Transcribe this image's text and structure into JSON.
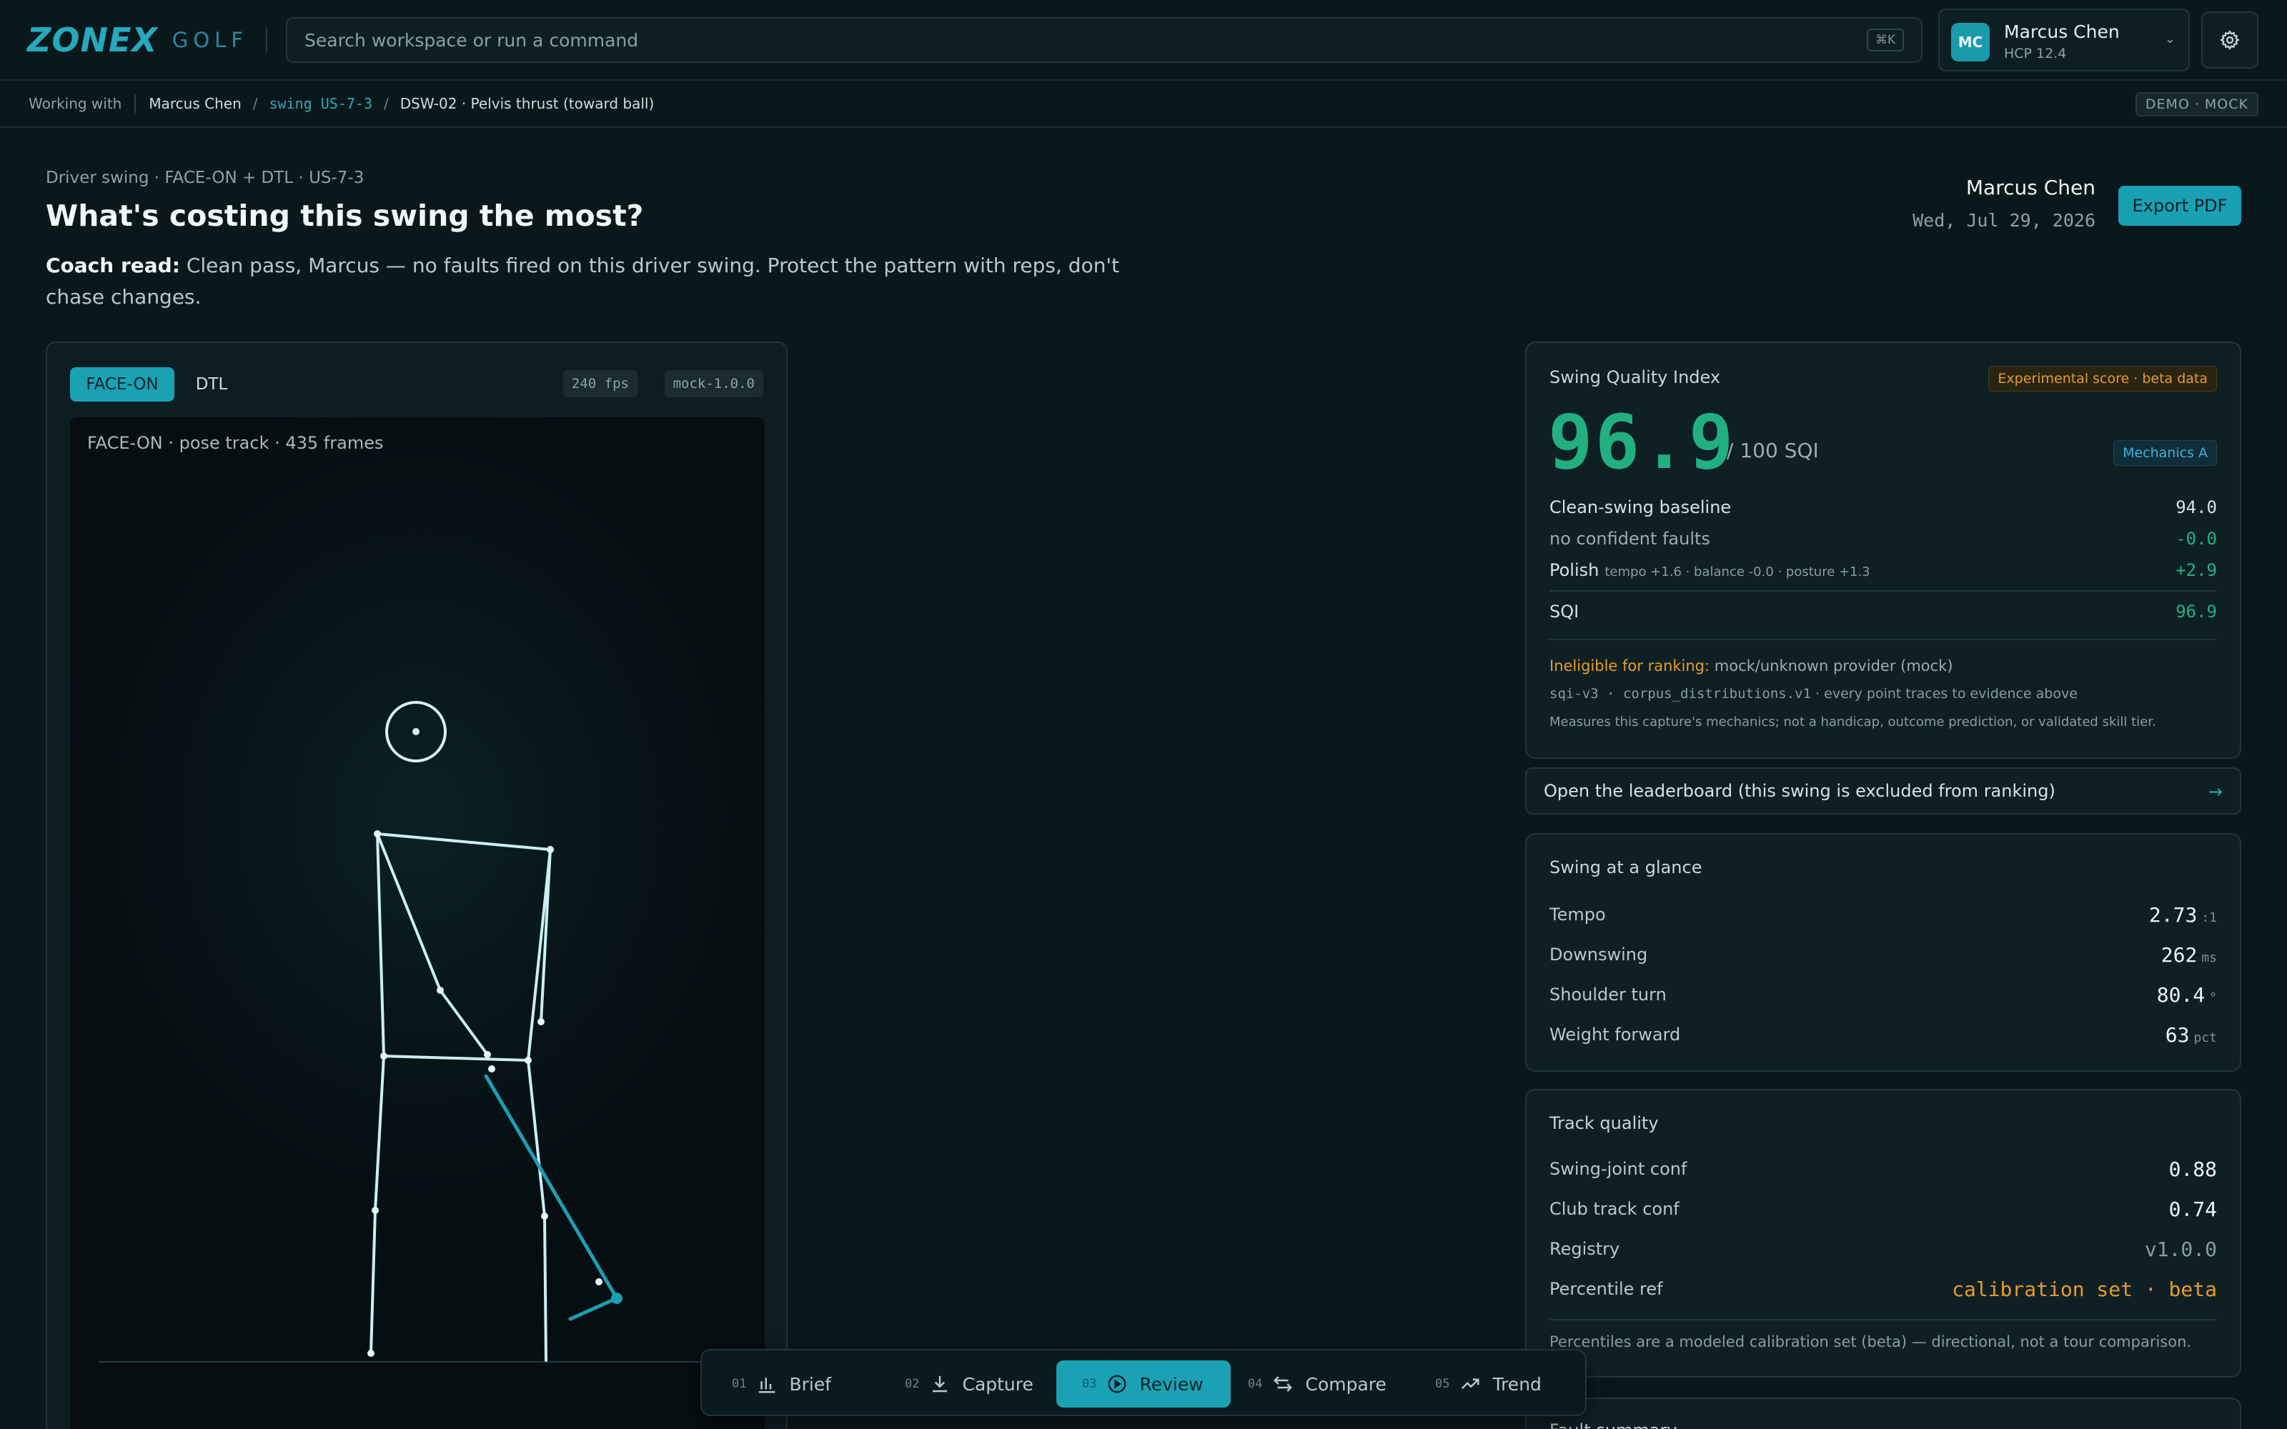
{
  "app": {
    "logo": "ZONEX",
    "logo_sub": "GOLF",
    "search_placeholder": "Search workspace or run a command",
    "search_shortcut": "⌘K",
    "user": {
      "initials": "MC",
      "name": "Marcus Chen",
      "hcp": "HCP 12.4"
    }
  },
  "breadcrumb": {
    "label": "Working with",
    "player": "Marcus Chen",
    "swing": "swing US-7-3",
    "drill": "DSW-02 · Pelvis thrust (toward ball)",
    "badge": "DEMO · MOCK"
  },
  "header": {
    "pre_title": "Driver swing · FACE-ON + DTL · US-7-3",
    "title": "What's costing this swing the most?",
    "coach_label": "Coach read:",
    "coach_text": "Clean pass, Marcus — no faults fired on this driver swing. Protect the pattern with reps, don't chase changes.",
    "player_name": "Marcus Chen",
    "date": "Wed, Jul 29, 2026",
    "export_label": "Export PDF"
  },
  "video": {
    "tabs": [
      {
        "label": "FACE-ON",
        "active": true
      },
      {
        "label": "DTL",
        "active": false
      }
    ],
    "fps": "240 fps",
    "model": "mock-1.0.0",
    "canvas_label": "FACE-ON · pose track · 435 frames"
  },
  "sqi": {
    "title": "Swing Quality Index",
    "badge": "Experimental score · beta data",
    "score": "96.9",
    "unit": "/ 100 SQI",
    "grade": "Mechanics A",
    "rows": [
      {
        "label": "Clean-swing baseline",
        "detail": "",
        "value": "94.0"
      },
      {
        "label": "no confident faults",
        "detail": "",
        "value": "-0.0"
      },
      {
        "label": "Polish",
        "detail": "tempo +1.6 · balance -0.0 · posture +1.3",
        "value": "+2.9"
      }
    ],
    "total_label": "SQI",
    "total_value": "96.9",
    "inelig_label": "Ineligible for ranking:",
    "inelig_text": "mock/unknown provider (mock)",
    "trace_code": "sqi-v3 · corpus_distributions.v1",
    "trace_text": "· every point traces to evidence above",
    "measures": "Measures this capture's mechanics; not a handicap, outcome prediction, or validated skill tier."
  },
  "leaderboard": {
    "label": "Open the leaderboard (this swing is excluded from ranking)"
  },
  "glance": {
    "title": "Swing at a glance",
    "rows": [
      {
        "label": "Tempo",
        "value": "2.73",
        "unit": ":1"
      },
      {
        "label": "Downswing",
        "value": "262",
        "unit": "ms"
      },
      {
        "label": "Shoulder turn",
        "value": "80.4",
        "unit": "°"
      },
      {
        "label": "Weight forward",
        "value": "63",
        "unit": "pct"
      }
    ]
  },
  "track": {
    "title": "Track quality",
    "rows": [
      {
        "label": "Swing-joint conf",
        "value": "0.88"
      },
      {
        "label": "Club track conf",
        "value": "0.74"
      },
      {
        "label": "Registry",
        "value": "v1.0.0"
      },
      {
        "label": "Percentile ref",
        "value": "calibration set · beta"
      }
    ],
    "note": "Percentiles are a modeled calibration set (beta) — directional, not a tour comparison."
  },
  "fault": {
    "title": "Fault summary"
  },
  "nav": [
    {
      "num": "01",
      "label": "Brief"
    },
    {
      "num": "02",
      "label": "Capture"
    },
    {
      "num": "03",
      "label": "Review"
    },
    {
      "num": "04",
      "label": "Compare"
    },
    {
      "num": "05",
      "label": "Trend"
    }
  ],
  "colors": {
    "accent": "#1aa1b4",
    "good": "#22b080",
    "warn": "#e79b2a",
    "bg": "#0a181c"
  }
}
